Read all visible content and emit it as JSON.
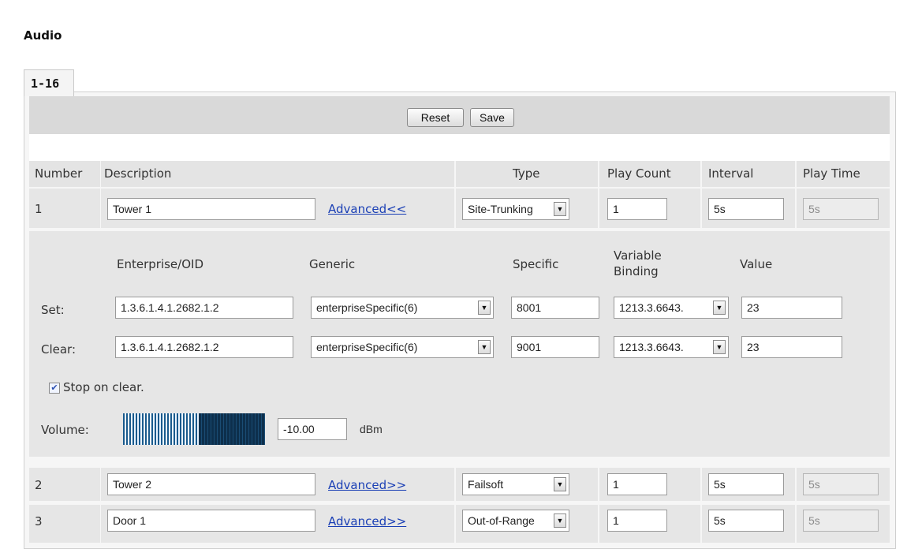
{
  "page": {
    "title": "Audio"
  },
  "tabs": [
    {
      "label": "1-16"
    }
  ],
  "toolbar": {
    "reset_label": "Reset",
    "save_label": "Save"
  },
  "table": {
    "headers": {
      "number": "Number",
      "description": "Description",
      "type": "Type",
      "play_count": "Play Count",
      "interval": "Interval",
      "play_time": "Play Time"
    },
    "rows": [
      {
        "number": "1",
        "description": "Tower 1",
        "advanced_link": "Advanced<<",
        "type": "Site-Trunking",
        "play_count": "1",
        "interval": "5s",
        "play_time": "5s"
      },
      {
        "number": "2",
        "description": "Tower 2",
        "advanced_link": "Advanced>>",
        "type": "Failsoft",
        "play_count": "1",
        "interval": "5s",
        "play_time": "5s"
      },
      {
        "number": "3",
        "description": "Door 1",
        "advanced_link": "Advanced>>",
        "type": "Out-of-Range",
        "play_count": "1",
        "interval": "5s",
        "play_time": "5s"
      }
    ]
  },
  "advanced": {
    "headers": {
      "enterprise_oid": "Enterprise/OID",
      "generic": "Generic",
      "specific": "Specific",
      "variable_binding": "Variable Binding",
      "value": "Value"
    },
    "set": {
      "label": "Set:",
      "oid": "1.3.6.1.4.1.2682.1.2",
      "generic": "enterpriseSpecific(6)",
      "specific": "8001",
      "binding": "1213.3.6643.",
      "value": "23"
    },
    "clear": {
      "label": "Clear:",
      "oid": "1.3.6.1.4.1.2682.1.2",
      "generic": "enterpriseSpecific(6)",
      "specific": "9001",
      "binding": "1213.3.6643.",
      "value": "23"
    },
    "stop_on_clear": {
      "label": "Stop on clear.",
      "checked": true
    },
    "volume": {
      "label": "Volume:",
      "value": "-10.00",
      "unit": "dBm"
    }
  },
  "icons": {
    "dropdown": "chevron-down-icon",
    "check": "checkmark-icon"
  },
  "colors": {
    "link": "#1a3fb5",
    "volume_bar": "#1a5a8c",
    "toolbar": "#d9d9d9"
  }
}
